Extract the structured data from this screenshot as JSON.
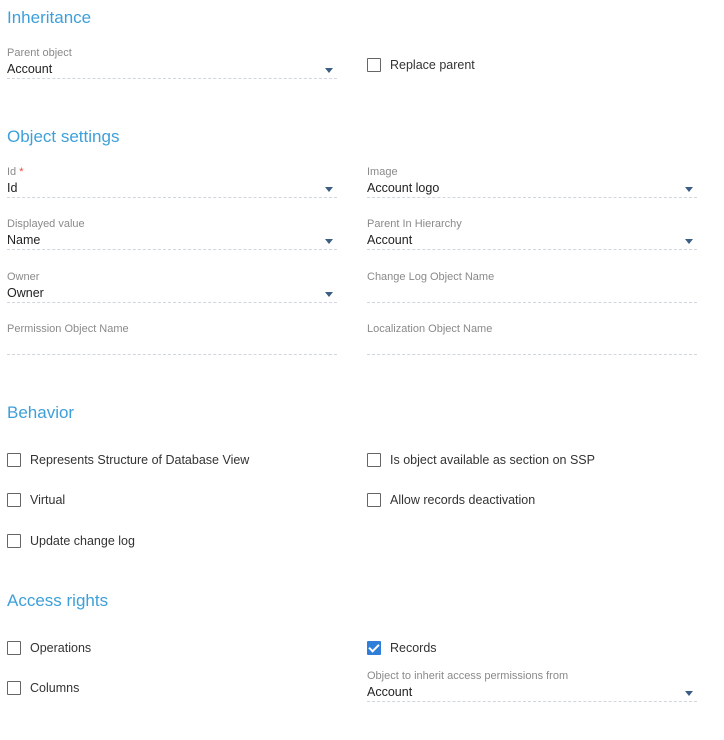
{
  "inheritance": {
    "title": "Inheritance",
    "parent_object": {
      "label": "Parent object",
      "value": "Account"
    },
    "replace_parent": {
      "label": "Replace parent",
      "checked": false
    }
  },
  "object_settings": {
    "title": "Object settings",
    "id": {
      "label": "Id",
      "required_mark": "*",
      "value": "Id"
    },
    "image": {
      "label": "Image",
      "value": "Account logo"
    },
    "displayed_value": {
      "label": "Displayed value",
      "value": "Name"
    },
    "parent_in_hierarchy": {
      "label": "Parent In Hierarchy",
      "value": "Account"
    },
    "owner": {
      "label": "Owner",
      "value": "Owner"
    },
    "change_log_object_name": {
      "label": "Change Log Object Name",
      "value": ""
    },
    "permission_object_name": {
      "label": "Permission Object Name",
      "value": ""
    },
    "localization_object_name": {
      "label": "Localization Object Name",
      "value": ""
    }
  },
  "behavior": {
    "title": "Behavior",
    "represents_structure": {
      "label": "Represents Structure of Database View",
      "checked": false
    },
    "available_on_ssp": {
      "label": "Is object available as section on SSP",
      "checked": false
    },
    "virtual": {
      "label": "Virtual",
      "checked": false
    },
    "allow_deactivation": {
      "label": "Allow records deactivation",
      "checked": false
    },
    "update_change_log": {
      "label": "Update change log",
      "checked": false
    }
  },
  "access_rights": {
    "title": "Access rights",
    "operations": {
      "label": "Operations",
      "checked": false
    },
    "records": {
      "label": "Records",
      "checked": true
    },
    "columns": {
      "label": "Columns",
      "checked": false
    },
    "inherit_from": {
      "label": "Object to inherit access permissions from",
      "value": "Account"
    }
  },
  "colors": {
    "accent": "#3da0d9",
    "checkbox_on": "#2f7ed8",
    "dropdown_arrow": "#3b5e82"
  }
}
